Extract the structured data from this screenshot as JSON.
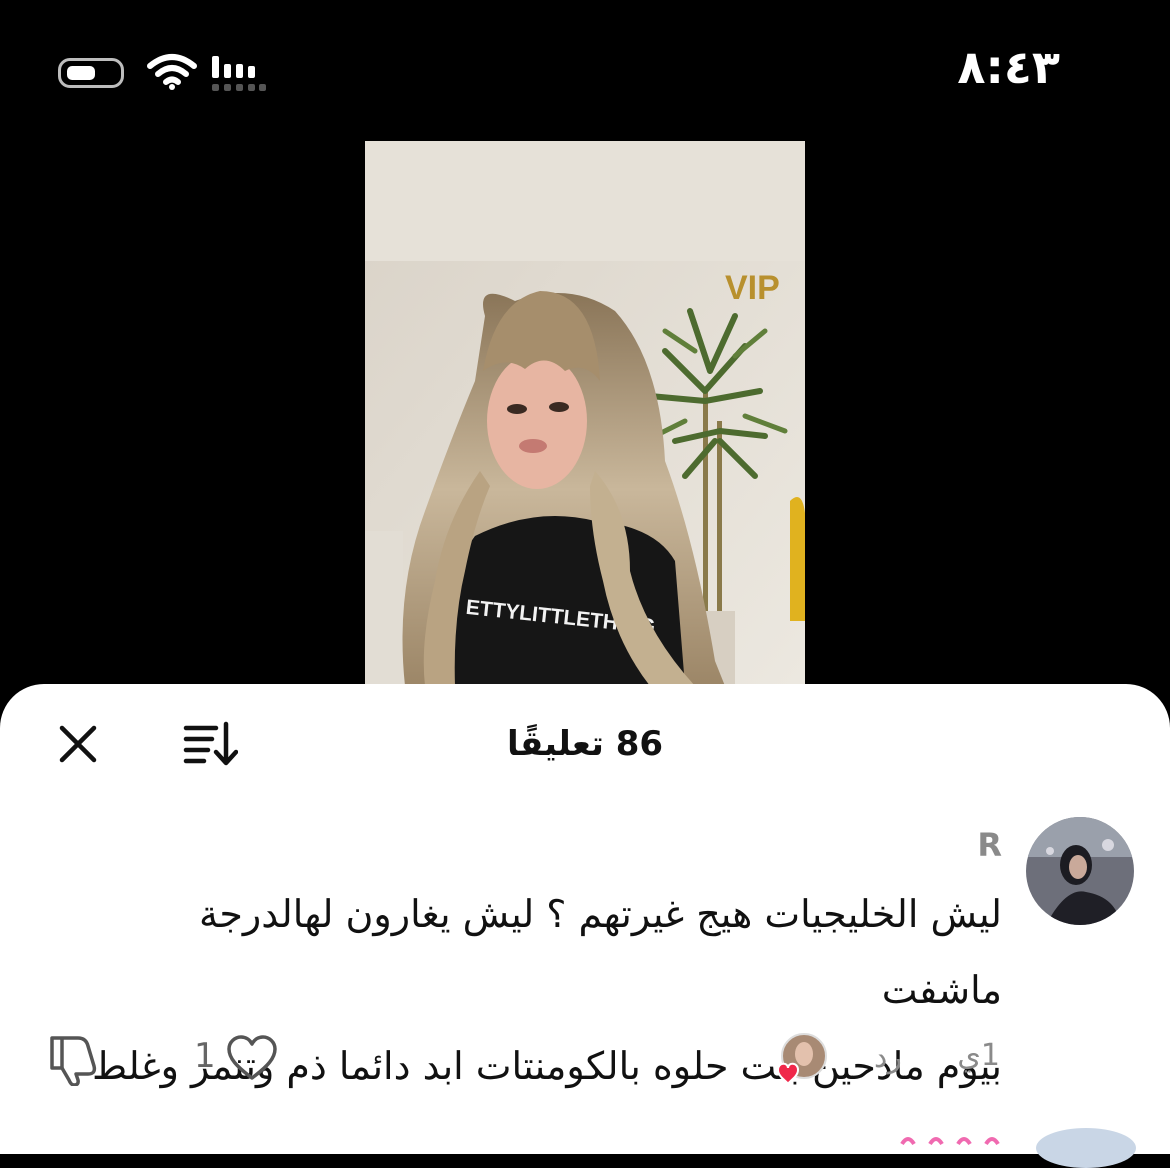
{
  "status_bar": {
    "time": "٨:٤٣",
    "icons": [
      "battery-icon",
      "wifi-icon",
      "signal-icon"
    ]
  },
  "video": {
    "shirt_text": "ETTYLITTLETHING",
    "sign_text": "VIP"
  },
  "comments_sheet": {
    "count_label": "86 تعليقًا",
    "close_icon": "close-icon",
    "sort_icon": "sort-icon"
  },
  "comment": {
    "username": "R",
    "text_line1": "ليش الخليجيات هيج غيرتهم ؟ ليش يغارون لهالدرجة ماشفت",
    "text_line2": "بيوم مادحين بنت حلوه بالكومنتات ابد دائما ذم وتنمر وغلط",
    "time": "1ي",
    "reply_label": "رد",
    "like_count": "1"
  },
  "colors": {
    "background": "#000000",
    "sheet": "#ffffff",
    "muted_text": "#8a8a8a",
    "heart_red": "#f0284a"
  }
}
